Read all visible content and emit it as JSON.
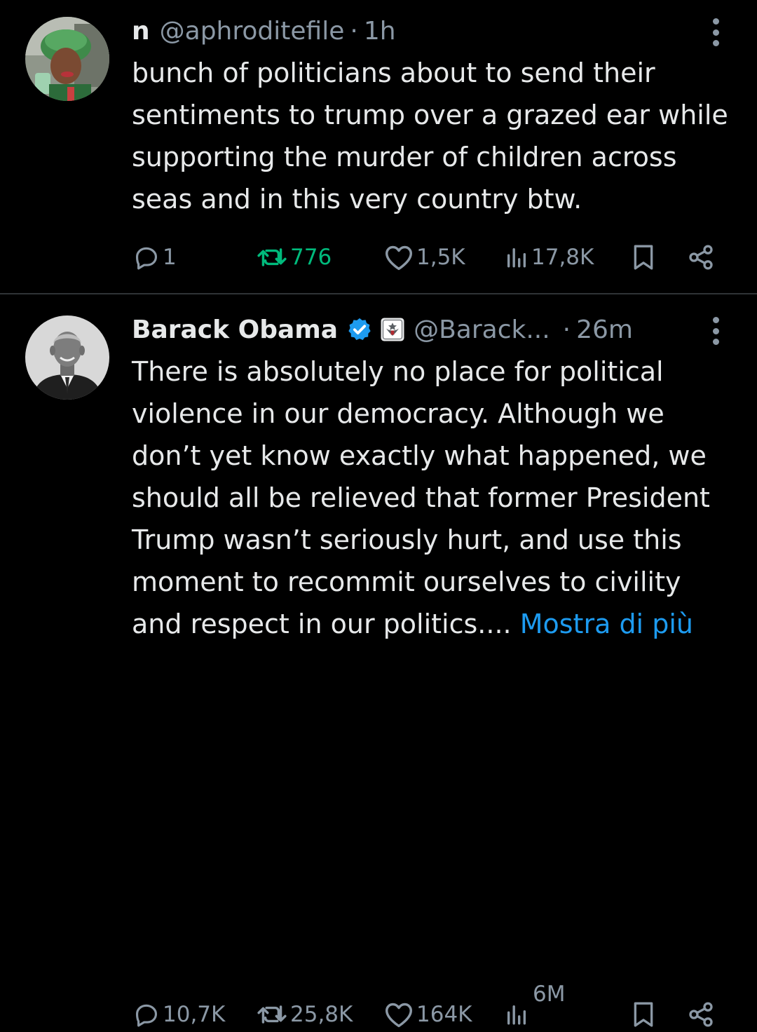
{
  "colors": {
    "background": "#000000",
    "text": "#e7e9ea",
    "muted": "#8b98a5",
    "link": "#1d9bf0",
    "retweet_active": "#00ba7c",
    "verified": "#1d9bf0",
    "divider": "#2f3336"
  },
  "tweets": [
    {
      "display_name": "n",
      "handle": "@aphroditefile",
      "separator": "·",
      "time": "1h",
      "text": "bunch of politicians about to send their sentiments to trump over a grazed ear while supporting the murder of children across seas and in this very country btw.",
      "actions": {
        "replies": "1",
        "retweets": "776",
        "likes": "1,5K",
        "views": "17,8K"
      },
      "icons": [
        "reply-icon",
        "retweet-icon",
        "like-icon",
        "views-icon",
        "bookmark-icon",
        "share-icon",
        "more-options-icon"
      ]
    },
    {
      "display_name": "Barack Obama",
      "handle": "@Barack...",
      "separator": "·",
      "time": "26m",
      "text": "There is absolutely no place for political violence in our democracy. Although we don’t yet know exactly what happened, we should all be relieved that former President Trump wasn’t seriously hurt, and use this moment to recommit ourselves to civility and respect in our politics....",
      "show_more": "Mostra di più",
      "actions": {
        "replies": "10,7K",
        "retweets": "25,8K",
        "likes": "164K",
        "views": "6M"
      },
      "icons": [
        "verified-badge-icon",
        "government-seal-icon",
        "reply-icon",
        "retweet-icon",
        "like-icon",
        "views-icon",
        "bookmark-icon",
        "share-icon",
        "more-options-icon"
      ]
    }
  ]
}
